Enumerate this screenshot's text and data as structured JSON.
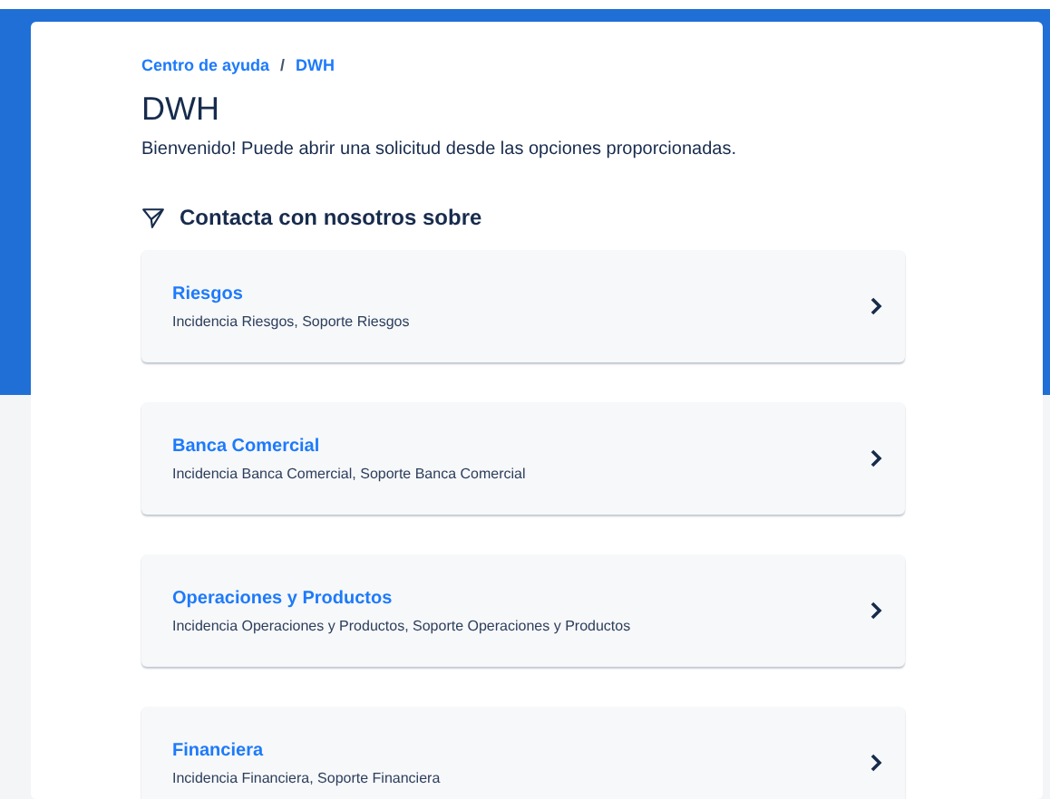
{
  "breadcrumb": [
    "Centro de ayuda",
    "DWH"
  ],
  "breadcrumb_separator": "/",
  "title": "DWH",
  "welcome": "Bienvenido! Puede abrir una solicitud desde las opciones proporcionadas.",
  "section_heading": "Contacta con nosotros sobre",
  "categories": [
    {
      "title": "Riesgos",
      "description": "Incidencia Riesgos, Soporte Riesgos"
    },
    {
      "title": "Banca Comercial",
      "description": "Incidencia Banca Comercial, Soporte Banca Comercial"
    },
    {
      "title": "Operaciones y Productos",
      "description": "Incidencia Operaciones y Productos, Soporte Operaciones y Productos"
    },
    {
      "title": "Financiera",
      "description": "Incidencia Financiera, Soporte Financiera"
    }
  ]
}
